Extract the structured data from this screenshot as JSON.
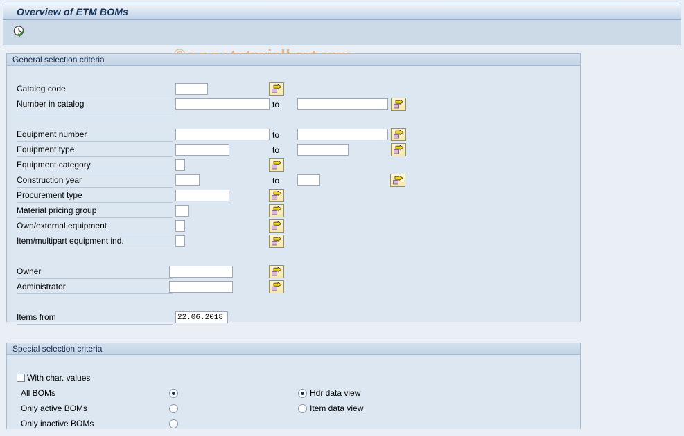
{
  "window": {
    "title": "Overview of ETM BOMs"
  },
  "toolbar": {
    "execute_icon": "clock-check-execute-icon",
    "execute_tooltip": "Execute"
  },
  "watermark": {
    "text": "© www.tutorialkart.com",
    "color": "#e8b584"
  },
  "general_panel": {
    "title": "General selection criteria",
    "rows": [
      {
        "label": "Catalog code",
        "value": "",
        "to_label": "",
        "to_value": "",
        "multi_icon": "multiple-selection-icon"
      },
      {
        "label": "Number in catalog",
        "value": "",
        "to_label": "to",
        "to_value": "",
        "multi_icon": "multiple-selection-icon"
      },
      {
        "label": "Equipment number",
        "value": "",
        "to_label": "to",
        "to_value": "",
        "multi_icon": "multiple-selection-icon"
      },
      {
        "label": "Equipment type",
        "value": "",
        "to_label": "to",
        "to_value": "",
        "multi_icon": "multiple-selection-icon"
      },
      {
        "label": "Equipment category",
        "value": "",
        "to_label": "",
        "to_value": "",
        "multi_icon": "multiple-selection-icon"
      },
      {
        "label": "Construction year",
        "value": "",
        "to_label": "to",
        "to_value": "",
        "multi_icon": "multiple-selection-icon"
      },
      {
        "label": "Procurement type",
        "value": "",
        "to_label": "",
        "to_value": "",
        "multi_icon": "multiple-selection-icon"
      },
      {
        "label": "Material pricing group",
        "value": "",
        "to_label": "",
        "to_value": "",
        "multi_icon": "multiple-selection-icon"
      },
      {
        "label": "Own/external equipment",
        "value": "",
        "to_label": "",
        "to_value": "",
        "multi_icon": "multiple-selection-icon"
      },
      {
        "label": "Item/multipart equipment ind.",
        "value": "",
        "to_label": "",
        "to_value": "",
        "multi_icon": "multiple-selection-icon"
      },
      {
        "label": "Owner",
        "value": "",
        "to_label": "",
        "to_value": "",
        "multi_icon": "multiple-selection-icon"
      },
      {
        "label": "Administrator",
        "value": "",
        "to_label": "",
        "to_value": "",
        "multi_icon": "multiple-selection-icon"
      },
      {
        "label": "Items from",
        "value": "22.06.2018",
        "to_label": "",
        "to_value": "",
        "multi_icon": ""
      }
    ]
  },
  "special_panel": {
    "title": "Special selection criteria",
    "checkbox": {
      "label": "With char. values",
      "checked": false
    },
    "bom_scope": [
      {
        "label": "All BOMs",
        "selected": true
      },
      {
        "label": "Only active BOMs",
        "selected": false
      },
      {
        "label": "Only inactive BOMs",
        "selected": false
      }
    ],
    "view_mode": [
      {
        "label": "Hdr data view",
        "selected": true
      },
      {
        "label": "Item data view",
        "selected": false
      }
    ]
  },
  "colors": {
    "panel_bg": "#dce7f1",
    "page_bg": "#eaeff5",
    "toolbar_bg": "#ccd9e6",
    "title_text": "#16335b",
    "field_border": "#9fa8b4",
    "button_yellow": "#f6e9ac"
  }
}
